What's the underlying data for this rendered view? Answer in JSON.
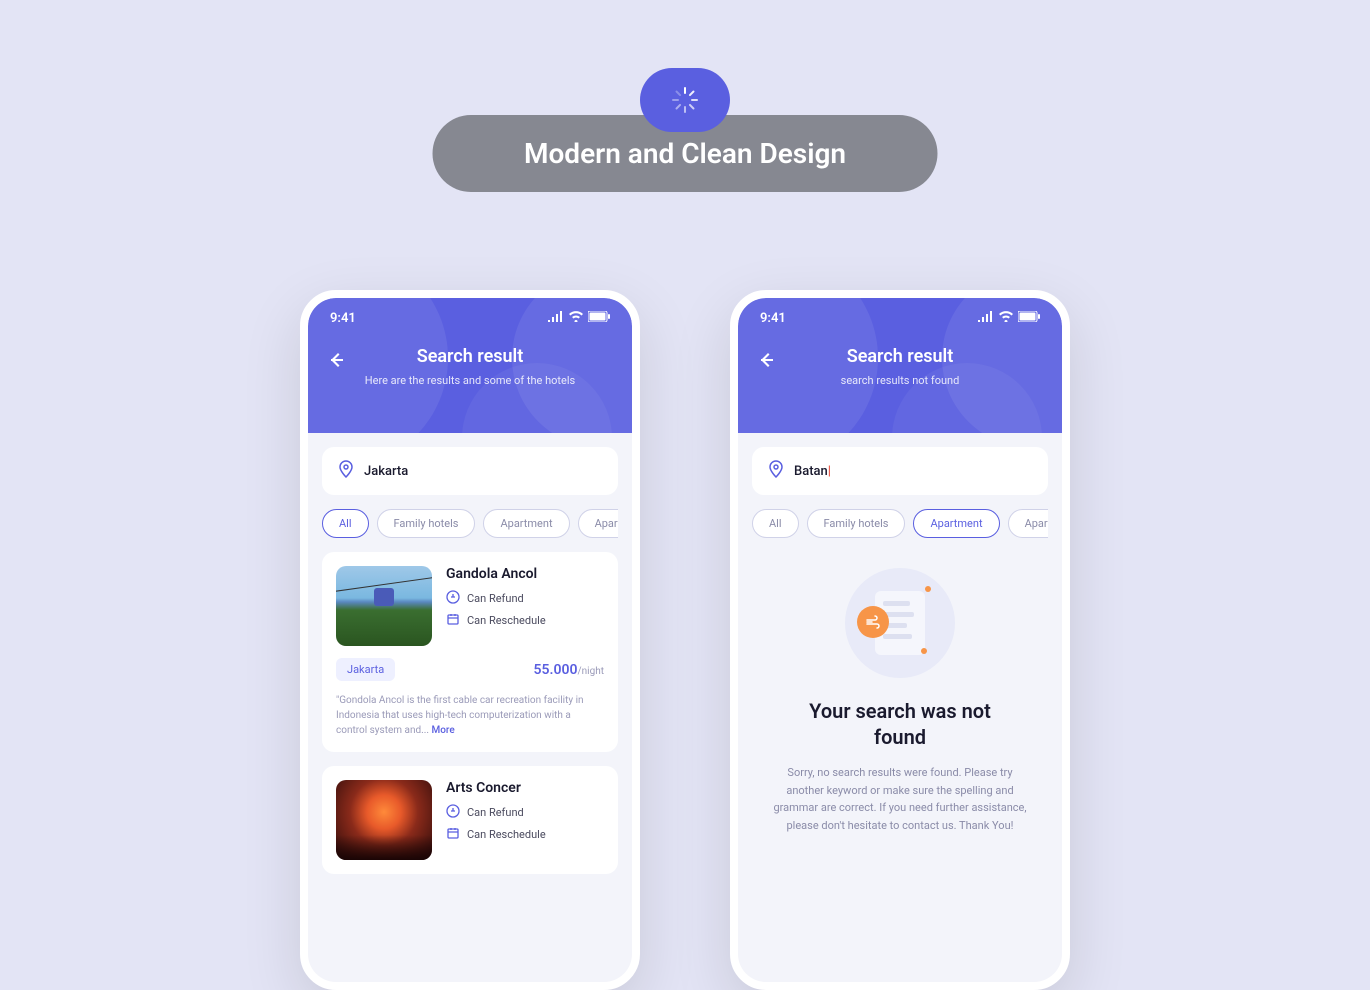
{
  "banner": {
    "title": "Modern and Clean Design"
  },
  "status": {
    "time": "9:41"
  },
  "screen1": {
    "title": "Search result",
    "subtitle": "Here are the results and some of the hotels",
    "search": "Jakarta",
    "filters": [
      "All",
      "Family hotels",
      "Apartment",
      "Apart"
    ],
    "active_filter": 0,
    "results": [
      {
        "title": "Gandola Ancol",
        "feat1": "Can Refund",
        "feat2": "Can Reschedule",
        "tag": "Jakarta",
        "price": "55.000",
        "price_unit": "/night",
        "desc": "\"Gondola Ancol is the first cable car recreation facility in Indonesia that uses high-tech computerization with a control system and...",
        "more": "More"
      },
      {
        "title": "Arts Concer",
        "feat1": "Can Refund",
        "feat2": "Can Reschedule"
      }
    ]
  },
  "screen2": {
    "title": "Search result",
    "subtitle": "search results not found",
    "search": "Batan",
    "filters": [
      "All",
      "Family hotels",
      "Apartment",
      "Apart"
    ],
    "active_filter": 2,
    "empty": {
      "title": "Your search was not found",
      "message": "Sorry, no search results were found. Please try another keyword or make sure the spelling and grammar are correct. If you need further assistance, please don't hesitate to contact us. Thank You!"
    }
  }
}
